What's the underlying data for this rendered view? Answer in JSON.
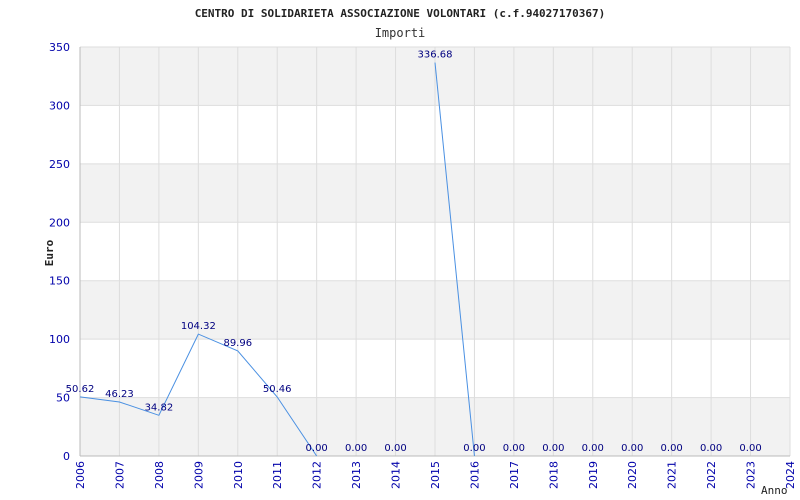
{
  "chart_data": {
    "type": "line",
    "title": "CENTRO DI SOLIDARIETA ASSOCIAZIONE VOLONTARI (c.f.94027170367)",
    "subtitle": "Importi",
    "ylabel": "Euro",
    "xlabel": "Anno",
    "ylim": [
      0,
      350
    ],
    "yticks": [
      0,
      50,
      100,
      150,
      200,
      250,
      300,
      350
    ],
    "grid": true,
    "categories": [
      "2006",
      "2007",
      "2008",
      "2009",
      "2010",
      "2011",
      "2012",
      "2013",
      "2014",
      "2015",
      "2016",
      "2017",
      "2018",
      "2019",
      "2020",
      "2021",
      "2022",
      "2023",
      "2024"
    ],
    "values": [
      50.62,
      46.23,
      34.82,
      104.32,
      89.96,
      50.46,
      0,
      null,
      null,
      336.68,
      0,
      null,
      null,
      null,
      null,
      null,
      null,
      null,
      null
    ],
    "labels": [
      "50.62",
      "46.23",
      "34.82",
      "104.32",
      "89.96",
      "50.46",
      "0.00",
      "0.00",
      "0.00",
      "336.68",
      "0.00",
      "0.00",
      "0.00",
      "0.00",
      "0.00",
      "0.00",
      "0.00",
      "0.00"
    ],
    "colors": {
      "line": "#4a90e2",
      "band": "#f2f2f2",
      "gridline": "#dddddd",
      "tick_text": "#0000aa",
      "label_text": "#000080"
    }
  }
}
